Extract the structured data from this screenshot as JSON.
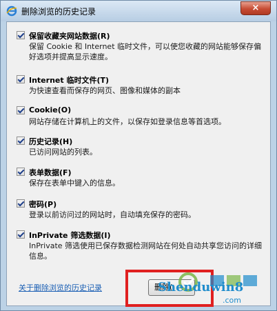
{
  "window": {
    "title": "删除浏览的历史记录",
    "close_label": "×"
  },
  "options": [
    {
      "label": "保留收藏夹网站数据(R)",
      "desc": "保留 Cookie 和 Internet 临时文件，可以使您收藏的网站能够保存偏好选项并提高显示速度。",
      "checked": true
    },
    {
      "label": "Internet 临时文件(T)",
      "desc": "为快速查看而保存的网页、图像和媒体的副本",
      "checked": true
    },
    {
      "label": "Cookie(O)",
      "desc": "网站存储在计算机上的文件，以保存如登录信息等首选项。",
      "checked": true
    },
    {
      "label": "历史记录(H)",
      "desc": "已访问网站的列表。",
      "checked": true
    },
    {
      "label": "表单数据(F)",
      "desc": "保存在表单中键入的信息。",
      "checked": true
    },
    {
      "label": "密码(P)",
      "desc": "登录以前访问过的网站时，自动填充保存的密码。",
      "checked": true
    },
    {
      "label": "InPrivate 筛选数据(I)",
      "desc": "InPrivate 筛选使用已保存数据检测网站在何处自动共享您访问的详细信息。",
      "checked": true
    }
  ],
  "footer": {
    "help_link": "关于删除浏览的历史记录",
    "delete_label": "删除("
  },
  "watermark": {
    "text": "Shenduwin8",
    "sub": ".com"
  },
  "colors": {
    "accent": "#e02020",
    "link": "#1a5fb4"
  }
}
